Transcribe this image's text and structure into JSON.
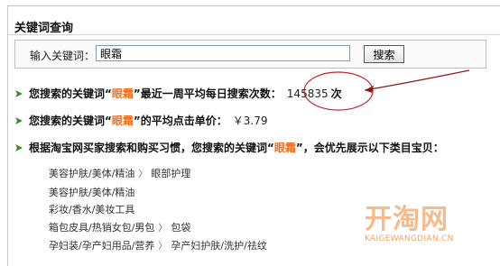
{
  "panel": {
    "title": "关键词查询"
  },
  "search": {
    "label": "输入关键词：",
    "value": "眼霜",
    "button": "搜索"
  },
  "results": {
    "daily": {
      "prefix": "您搜索的关键词“",
      "keyword": "眼霜",
      "suffix": "”最近一周平均每日搜索次数：",
      "value": "145835",
      "unit": "次"
    },
    "cpc": {
      "prefix": "您搜索的关键词“",
      "keyword": "眼霜",
      "suffix": "”的平均点击单价：",
      "value": "￥3.79"
    },
    "categories_intro": {
      "prefix": "根据淘宝网买家搜索和购买习惯，您搜索的关键词“",
      "keyword": "眼霜",
      "suffix": "”，会优先展示以下类目宝贝："
    }
  },
  "categories": [
    {
      "parts": [
        "美容护肤/美体/精油",
        "眼部护理"
      ]
    },
    {
      "parts": [
        "美容护肤/美体/精油"
      ]
    },
    {
      "parts": [
        "彩妆/香水/美妆工具"
      ]
    },
    {
      "parts": [
        "箱包皮具/热销女包/男包",
        "包袋"
      ]
    },
    {
      "parts": [
        "孕妇装/孕产妇用品/营养",
        "孕产妇护肤/洗护/祛纹"
      ]
    }
  ],
  "watermark": {
    "text": "开淘网",
    "domain": "KAIGEWANGDIAN.CN"
  },
  "colors": {
    "keyword": "#f26d1b",
    "arrow_icon": "#3d8a2a",
    "annotation": "#c0262d"
  },
  "icons": [
    "green-arrow-icon",
    "chevron-right-icon"
  ]
}
